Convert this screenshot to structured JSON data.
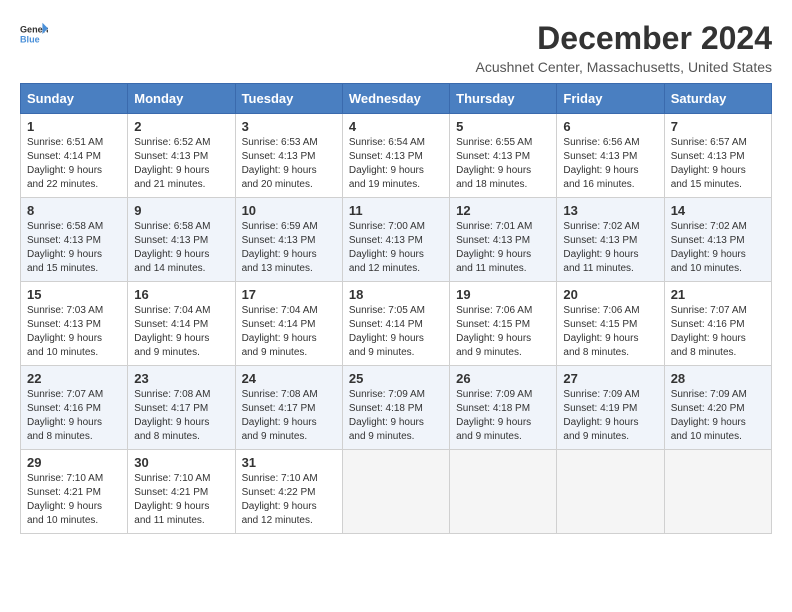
{
  "logo": {
    "line1": "General",
    "line2": "Blue"
  },
  "title": "December 2024",
  "location": "Acushnet Center, Massachusetts, United States",
  "days_of_week": [
    "Sunday",
    "Monday",
    "Tuesday",
    "Wednesday",
    "Thursday",
    "Friday",
    "Saturday"
  ],
  "weeks": [
    [
      {
        "day": "1",
        "sunrise": "6:51 AM",
        "sunset": "4:14 PM",
        "daylight": "9 hours and 22 minutes."
      },
      {
        "day": "2",
        "sunrise": "6:52 AM",
        "sunset": "4:13 PM",
        "daylight": "9 hours and 21 minutes."
      },
      {
        "day": "3",
        "sunrise": "6:53 AM",
        "sunset": "4:13 PM",
        "daylight": "9 hours and 20 minutes."
      },
      {
        "day": "4",
        "sunrise": "6:54 AM",
        "sunset": "4:13 PM",
        "daylight": "9 hours and 19 minutes."
      },
      {
        "day": "5",
        "sunrise": "6:55 AM",
        "sunset": "4:13 PM",
        "daylight": "9 hours and 18 minutes."
      },
      {
        "day": "6",
        "sunrise": "6:56 AM",
        "sunset": "4:13 PM",
        "daylight": "9 hours and 16 minutes."
      },
      {
        "day": "7",
        "sunrise": "6:57 AM",
        "sunset": "4:13 PM",
        "daylight": "9 hours and 15 minutes."
      }
    ],
    [
      {
        "day": "8",
        "sunrise": "6:58 AM",
        "sunset": "4:13 PM",
        "daylight": "9 hours and 15 minutes."
      },
      {
        "day": "9",
        "sunrise": "6:58 AM",
        "sunset": "4:13 PM",
        "daylight": "9 hours and 14 minutes."
      },
      {
        "day": "10",
        "sunrise": "6:59 AM",
        "sunset": "4:13 PM",
        "daylight": "9 hours and 13 minutes."
      },
      {
        "day": "11",
        "sunrise": "7:00 AM",
        "sunset": "4:13 PM",
        "daylight": "9 hours and 12 minutes."
      },
      {
        "day": "12",
        "sunrise": "7:01 AM",
        "sunset": "4:13 PM",
        "daylight": "9 hours and 11 minutes."
      },
      {
        "day": "13",
        "sunrise": "7:02 AM",
        "sunset": "4:13 PM",
        "daylight": "9 hours and 11 minutes."
      },
      {
        "day": "14",
        "sunrise": "7:02 AM",
        "sunset": "4:13 PM",
        "daylight": "9 hours and 10 minutes."
      }
    ],
    [
      {
        "day": "15",
        "sunrise": "7:03 AM",
        "sunset": "4:13 PM",
        "daylight": "9 hours and 10 minutes."
      },
      {
        "day": "16",
        "sunrise": "7:04 AM",
        "sunset": "4:14 PM",
        "daylight": "9 hours and 9 minutes."
      },
      {
        "day": "17",
        "sunrise": "7:04 AM",
        "sunset": "4:14 PM",
        "daylight": "9 hours and 9 minutes."
      },
      {
        "day": "18",
        "sunrise": "7:05 AM",
        "sunset": "4:14 PM",
        "daylight": "9 hours and 9 minutes."
      },
      {
        "day": "19",
        "sunrise": "7:06 AM",
        "sunset": "4:15 PM",
        "daylight": "9 hours and 9 minutes."
      },
      {
        "day": "20",
        "sunrise": "7:06 AM",
        "sunset": "4:15 PM",
        "daylight": "9 hours and 8 minutes."
      },
      {
        "day": "21",
        "sunrise": "7:07 AM",
        "sunset": "4:16 PM",
        "daylight": "9 hours and 8 minutes."
      }
    ],
    [
      {
        "day": "22",
        "sunrise": "7:07 AM",
        "sunset": "4:16 PM",
        "daylight": "9 hours and 8 minutes."
      },
      {
        "day": "23",
        "sunrise": "7:08 AM",
        "sunset": "4:17 PM",
        "daylight": "9 hours and 8 minutes."
      },
      {
        "day": "24",
        "sunrise": "7:08 AM",
        "sunset": "4:17 PM",
        "daylight": "9 hours and 9 minutes."
      },
      {
        "day": "25",
        "sunrise": "7:09 AM",
        "sunset": "4:18 PM",
        "daylight": "9 hours and 9 minutes."
      },
      {
        "day": "26",
        "sunrise": "7:09 AM",
        "sunset": "4:18 PM",
        "daylight": "9 hours and 9 minutes."
      },
      {
        "day": "27",
        "sunrise": "7:09 AM",
        "sunset": "4:19 PM",
        "daylight": "9 hours and 9 minutes."
      },
      {
        "day": "28",
        "sunrise": "7:09 AM",
        "sunset": "4:20 PM",
        "daylight": "9 hours and 10 minutes."
      }
    ],
    [
      {
        "day": "29",
        "sunrise": "7:10 AM",
        "sunset": "4:21 PM",
        "daylight": "9 hours and 10 minutes."
      },
      {
        "day": "30",
        "sunrise": "7:10 AM",
        "sunset": "4:21 PM",
        "daylight": "9 hours and 11 minutes."
      },
      {
        "day": "31",
        "sunrise": "7:10 AM",
        "sunset": "4:22 PM",
        "daylight": "9 hours and 12 minutes."
      },
      null,
      null,
      null,
      null
    ]
  ]
}
